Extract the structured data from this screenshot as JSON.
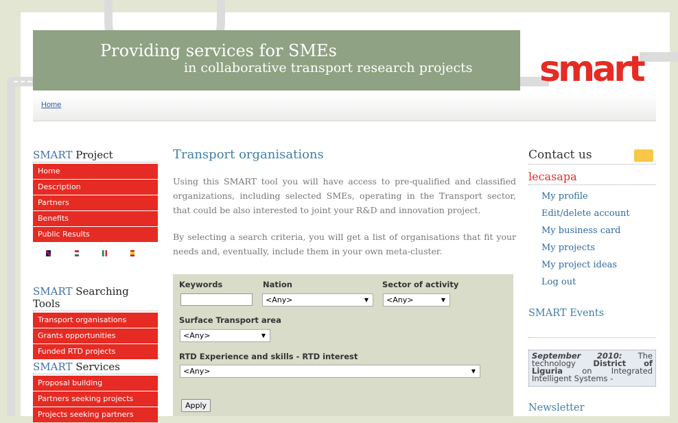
{
  "banner": {
    "line1": "Providing services for SMEs",
    "line2": "in collaborative transport research projects",
    "logo": "smart"
  },
  "breadcrumb": {
    "home": "Home"
  },
  "sidebar": {
    "project": {
      "title_prefix": "SMART",
      "title_suffix": " Project",
      "items": [
        "Home",
        "Description",
        "Partners",
        "Benefits",
        "Public Results"
      ]
    },
    "languages": [
      "uk-flag",
      "hungary-flag",
      "italy-flag",
      "spain-flag"
    ],
    "tools": {
      "title_prefix": "SMART",
      "title_suffix": " Searching Tools",
      "items": [
        "Transport organisations",
        "Grants opportunities",
        "Funded RTD projects"
      ]
    },
    "services": {
      "title_prefix": "SMART",
      "title_suffix": " Services",
      "items": [
        "Proposal building",
        "Partners seeking projects",
        "Projects seeking partners"
      ]
    }
  },
  "main": {
    "title": "Transport organisations",
    "para1": "Using this SMART tool you will have access to pre-qualified and classified organizations, including selected SMEs, operating in the Transport sector, that could be also interested to joint your R&D and innovation project.",
    "para2": "By selecting a search criteria, you will get a list of organisations that fit your needs and, eventually, include them in your own meta-cluster."
  },
  "form": {
    "keywords_label": "Keywords",
    "keywords_value": "",
    "nation_label": "Nation",
    "nation_value": "<Any>",
    "sector_label": "Sector of activity",
    "sector_value": "<Any>",
    "surface_label": "Surface Transport area",
    "surface_value": "<Any>",
    "rtd_label": "RTD Experience and skills - RTD interest",
    "rtd_value": "<Any>",
    "apply": "Apply"
  },
  "right": {
    "contact": "Contact us",
    "username": "lecasapa",
    "links": [
      "My profile",
      "Edit/delete account",
      "My business card",
      "My projects",
      "My project ideas",
      "Log out"
    ],
    "events_title": "SMART Events",
    "news_date": "September 2010:",
    "news_text_1": " The technology ",
    "news_bold": "District of Liguria",
    "news_text_2": " on Integrated Intelligent Systems -",
    "newsletter": "Newsletter"
  },
  "colors": {
    "accent_red": "#e52b23",
    "banner_green": "#8fa283",
    "link_blue": "#2f6aa0"
  }
}
